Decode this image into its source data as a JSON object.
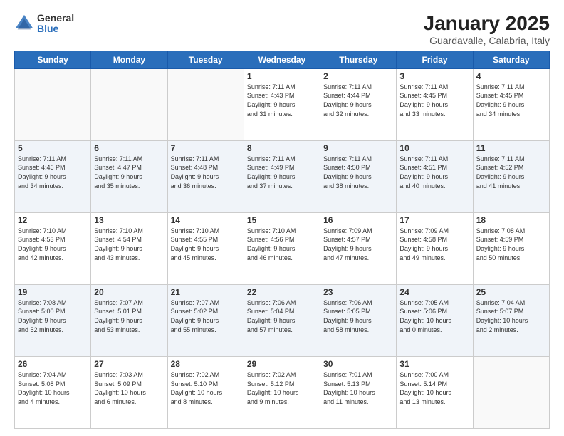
{
  "header": {
    "logo_general": "General",
    "logo_blue": "Blue",
    "title": "January 2025",
    "location": "Guardavalle, Calabria, Italy"
  },
  "days_of_week": [
    "Sunday",
    "Monday",
    "Tuesday",
    "Wednesday",
    "Thursday",
    "Friday",
    "Saturday"
  ],
  "weeks": [
    [
      {
        "day": "",
        "info": ""
      },
      {
        "day": "",
        "info": ""
      },
      {
        "day": "",
        "info": ""
      },
      {
        "day": "1",
        "info": "Sunrise: 7:11 AM\nSunset: 4:43 PM\nDaylight: 9 hours\nand 31 minutes."
      },
      {
        "day": "2",
        "info": "Sunrise: 7:11 AM\nSunset: 4:44 PM\nDaylight: 9 hours\nand 32 minutes."
      },
      {
        "day": "3",
        "info": "Sunrise: 7:11 AM\nSunset: 4:45 PM\nDaylight: 9 hours\nand 33 minutes."
      },
      {
        "day": "4",
        "info": "Sunrise: 7:11 AM\nSunset: 4:45 PM\nDaylight: 9 hours\nand 34 minutes."
      }
    ],
    [
      {
        "day": "5",
        "info": "Sunrise: 7:11 AM\nSunset: 4:46 PM\nDaylight: 9 hours\nand 34 minutes."
      },
      {
        "day": "6",
        "info": "Sunrise: 7:11 AM\nSunset: 4:47 PM\nDaylight: 9 hours\nand 35 minutes."
      },
      {
        "day": "7",
        "info": "Sunrise: 7:11 AM\nSunset: 4:48 PM\nDaylight: 9 hours\nand 36 minutes."
      },
      {
        "day": "8",
        "info": "Sunrise: 7:11 AM\nSunset: 4:49 PM\nDaylight: 9 hours\nand 37 minutes."
      },
      {
        "day": "9",
        "info": "Sunrise: 7:11 AM\nSunset: 4:50 PM\nDaylight: 9 hours\nand 38 minutes."
      },
      {
        "day": "10",
        "info": "Sunrise: 7:11 AM\nSunset: 4:51 PM\nDaylight: 9 hours\nand 40 minutes."
      },
      {
        "day": "11",
        "info": "Sunrise: 7:11 AM\nSunset: 4:52 PM\nDaylight: 9 hours\nand 41 minutes."
      }
    ],
    [
      {
        "day": "12",
        "info": "Sunrise: 7:10 AM\nSunset: 4:53 PM\nDaylight: 9 hours\nand 42 minutes."
      },
      {
        "day": "13",
        "info": "Sunrise: 7:10 AM\nSunset: 4:54 PM\nDaylight: 9 hours\nand 43 minutes."
      },
      {
        "day": "14",
        "info": "Sunrise: 7:10 AM\nSunset: 4:55 PM\nDaylight: 9 hours\nand 45 minutes."
      },
      {
        "day": "15",
        "info": "Sunrise: 7:10 AM\nSunset: 4:56 PM\nDaylight: 9 hours\nand 46 minutes."
      },
      {
        "day": "16",
        "info": "Sunrise: 7:09 AM\nSunset: 4:57 PM\nDaylight: 9 hours\nand 47 minutes."
      },
      {
        "day": "17",
        "info": "Sunrise: 7:09 AM\nSunset: 4:58 PM\nDaylight: 9 hours\nand 49 minutes."
      },
      {
        "day": "18",
        "info": "Sunrise: 7:08 AM\nSunset: 4:59 PM\nDaylight: 9 hours\nand 50 minutes."
      }
    ],
    [
      {
        "day": "19",
        "info": "Sunrise: 7:08 AM\nSunset: 5:00 PM\nDaylight: 9 hours\nand 52 minutes."
      },
      {
        "day": "20",
        "info": "Sunrise: 7:07 AM\nSunset: 5:01 PM\nDaylight: 9 hours\nand 53 minutes."
      },
      {
        "day": "21",
        "info": "Sunrise: 7:07 AM\nSunset: 5:02 PM\nDaylight: 9 hours\nand 55 minutes."
      },
      {
        "day": "22",
        "info": "Sunrise: 7:06 AM\nSunset: 5:04 PM\nDaylight: 9 hours\nand 57 minutes."
      },
      {
        "day": "23",
        "info": "Sunrise: 7:06 AM\nSunset: 5:05 PM\nDaylight: 9 hours\nand 58 minutes."
      },
      {
        "day": "24",
        "info": "Sunrise: 7:05 AM\nSunset: 5:06 PM\nDaylight: 10 hours\nand 0 minutes."
      },
      {
        "day": "25",
        "info": "Sunrise: 7:04 AM\nSunset: 5:07 PM\nDaylight: 10 hours\nand 2 minutes."
      }
    ],
    [
      {
        "day": "26",
        "info": "Sunrise: 7:04 AM\nSunset: 5:08 PM\nDaylight: 10 hours\nand 4 minutes."
      },
      {
        "day": "27",
        "info": "Sunrise: 7:03 AM\nSunset: 5:09 PM\nDaylight: 10 hours\nand 6 minutes."
      },
      {
        "day": "28",
        "info": "Sunrise: 7:02 AM\nSunset: 5:10 PM\nDaylight: 10 hours\nand 8 minutes."
      },
      {
        "day": "29",
        "info": "Sunrise: 7:02 AM\nSunset: 5:12 PM\nDaylight: 10 hours\nand 9 minutes."
      },
      {
        "day": "30",
        "info": "Sunrise: 7:01 AM\nSunset: 5:13 PM\nDaylight: 10 hours\nand 11 minutes."
      },
      {
        "day": "31",
        "info": "Sunrise: 7:00 AM\nSunset: 5:14 PM\nDaylight: 10 hours\nand 13 minutes."
      },
      {
        "day": "",
        "info": ""
      }
    ]
  ]
}
